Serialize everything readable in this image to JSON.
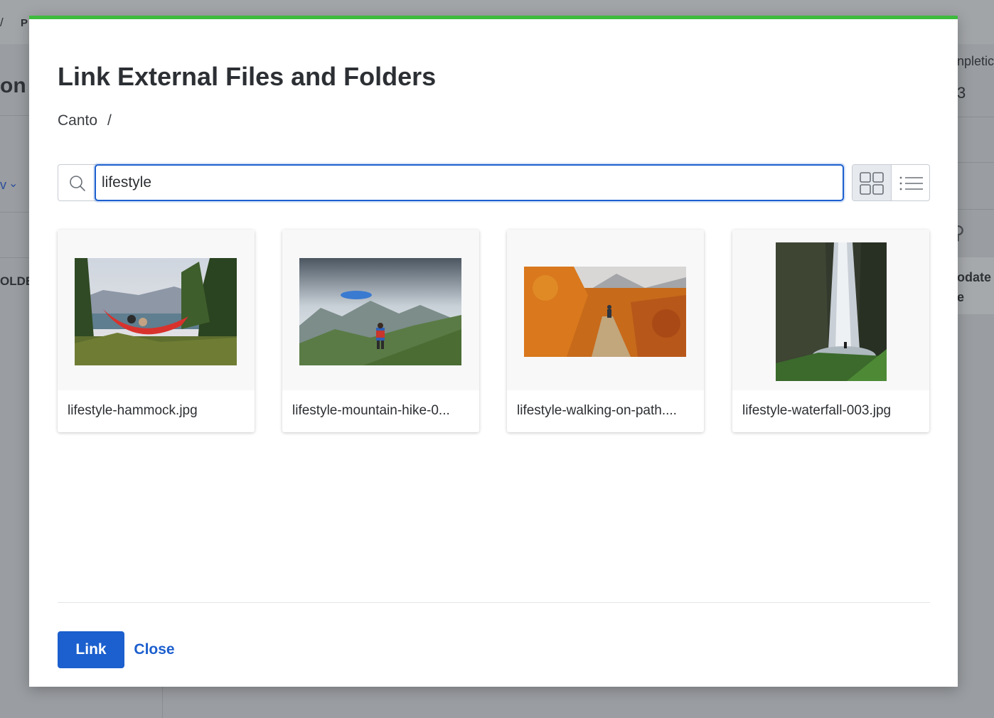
{
  "background": {
    "breadcrumb_slash": "/",
    "breadcrumb_fragment": "P",
    "title_fragment": "on",
    "dropdown_fragment": "v",
    "column_fragment": "OLDE",
    "right_label_1": "npletic",
    "right_value_1": "3",
    "right_label_2": "odate",
    "right_label_3": "e"
  },
  "modal": {
    "accent_color": "#3dbb3d",
    "title": "Link External Files and Folders",
    "breadcrumb": {
      "root": "Canto",
      "separator": "/"
    },
    "search": {
      "value": "lifestyle",
      "placeholder": "",
      "icon": "search-icon"
    },
    "view_toggle": {
      "active": "grid",
      "grid_icon": "grid-view-icon",
      "list_icon": "list-view-icon"
    },
    "files": [
      {
        "name": "lifestyle-hammock.jpg",
        "thumbnail": "hammock-lake-photo"
      },
      {
        "name": "lifestyle-mountain-hike-0...",
        "thumbnail": "mountain-hiker-photo"
      },
      {
        "name": "lifestyle-walking-on-path....",
        "thumbnail": "autumn-path-photo"
      },
      {
        "name": "lifestyle-waterfall-003.jpg",
        "thumbnail": "waterfall-photo"
      }
    ],
    "buttons": {
      "primary": "Link",
      "secondary": "Close"
    },
    "primary_color": "#1c5fce"
  }
}
